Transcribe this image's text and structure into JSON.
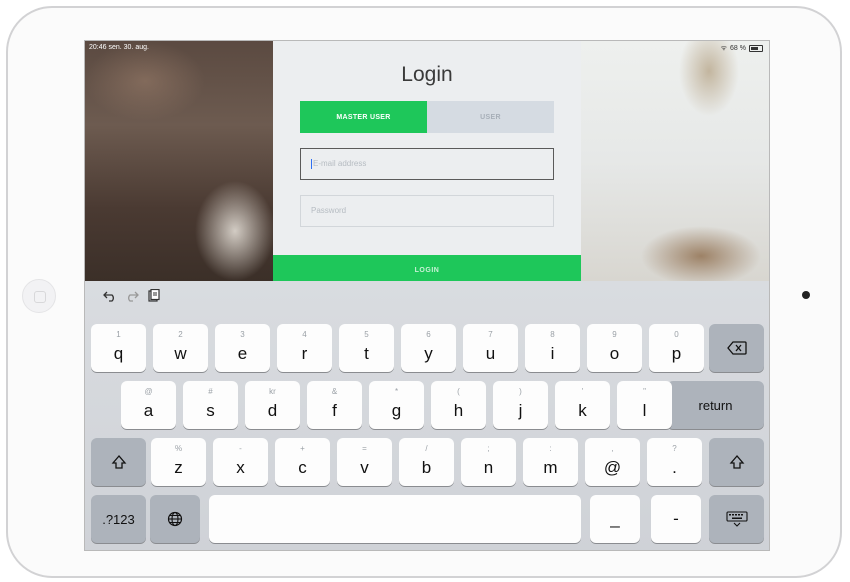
{
  "status_bar": {
    "time": "20:46 sen. 30. aug.",
    "battery": "68 %"
  },
  "login": {
    "title": "Login",
    "tabs": [
      "MASTER USER",
      "USER"
    ],
    "email_placeholder": "E-mail address",
    "password_placeholder": "Password",
    "login_label": "LOGIN"
  },
  "keyboard": {
    "row1": [
      {
        "hint": "1",
        "key": "q"
      },
      {
        "hint": "2",
        "key": "w"
      },
      {
        "hint": "3",
        "key": "e"
      },
      {
        "hint": "4",
        "key": "r"
      },
      {
        "hint": "5",
        "key": "t"
      },
      {
        "hint": "6",
        "key": "y"
      },
      {
        "hint": "7",
        "key": "u"
      },
      {
        "hint": "8",
        "key": "i"
      },
      {
        "hint": "9",
        "key": "o"
      },
      {
        "hint": "0",
        "key": "p"
      }
    ],
    "row2": [
      {
        "hint": "@",
        "key": "a"
      },
      {
        "hint": "#",
        "key": "s"
      },
      {
        "hint": "kr",
        "key": "d"
      },
      {
        "hint": "&",
        "key": "f"
      },
      {
        "hint": "*",
        "key": "g"
      },
      {
        "hint": "(",
        "key": "h"
      },
      {
        "hint": ")",
        "key": "j"
      },
      {
        "hint": "'",
        "key": "k"
      },
      {
        "hint": "\"",
        "key": "l"
      }
    ],
    "row3": [
      {
        "hint": "%",
        "key": "z"
      },
      {
        "hint": "-",
        "key": "x"
      },
      {
        "hint": "+",
        "key": "c"
      },
      {
        "hint": "=",
        "key": "v"
      },
      {
        "hint": "/",
        "key": "b"
      },
      {
        "hint": ";",
        "key": "n"
      },
      {
        "hint": ":",
        "key": "m"
      },
      {
        "hint": ",",
        "key": "@"
      },
      {
        "hint": "?",
        "key": "."
      }
    ],
    "return_label": "return",
    "numbers_label": ".?123",
    "underscore_key": "_",
    "dash_key": "-"
  },
  "icons": {
    "undo": "undo-icon",
    "redo": "redo-icon",
    "paste": "paste-icon",
    "backspace": "backspace-icon",
    "shift": "shift-icon",
    "globe": "globe-icon",
    "hide_keyboard": "keyboard-hide-icon"
  }
}
